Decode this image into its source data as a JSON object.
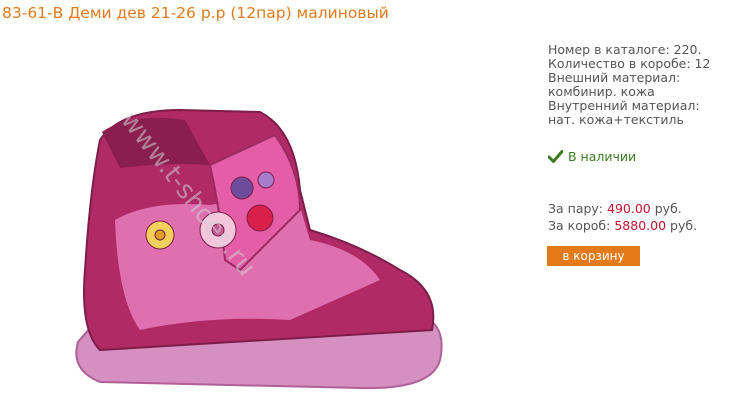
{
  "product": {
    "title": "83-61-В Деми дев 21-26 р.р (12пар) малиновый"
  },
  "details": {
    "catalog_number": "Номер в каталоге: 220.",
    "box_quantity": "Количество в коробе: 12",
    "outer_material_label": "Внешний материал:",
    "outer_material_value": "комбинир. кожа",
    "inner_material": "Внутренний материал: нат. кожа+текстиль"
  },
  "stock": {
    "label": "В наличии",
    "icon": "check-icon",
    "color": "#3b7a20"
  },
  "prices": {
    "pair_label": "За пару:",
    "pair_amount": "490.00",
    "pair_currency": "руб.",
    "box_label": "За короб:",
    "box_amount": "5880.00",
    "box_currency": "руб."
  },
  "cart": {
    "button_label": "в корзину"
  },
  "watermark": {
    "text": "www.t-shoes.ru"
  },
  "colors": {
    "title": "#e07b1a",
    "price": "#c4122f",
    "button": "#e57a1b"
  }
}
